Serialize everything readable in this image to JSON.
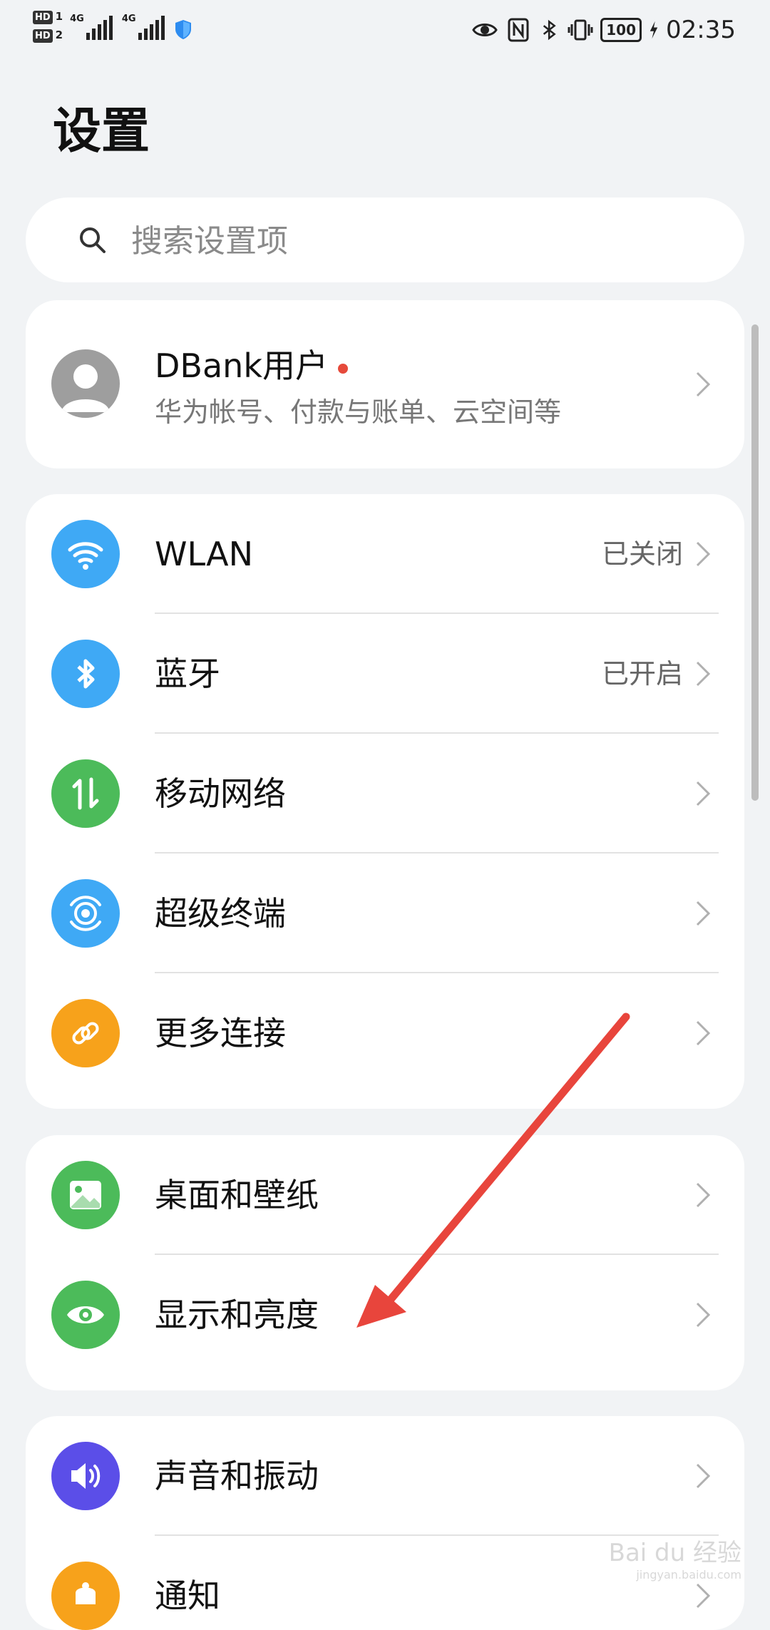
{
  "status_bar": {
    "sim1_label": "HD",
    "sim1_num": "1",
    "sim2_label": "HD",
    "sim2_num": "2",
    "network1": "4G",
    "network2": "4G",
    "battery": "100",
    "time": "02:35"
  },
  "page": {
    "title": "设置"
  },
  "search": {
    "placeholder": "搜索设置项"
  },
  "account": {
    "name": "DBank用户",
    "subtitle": "华为帐号、付款与账单、云空间等"
  },
  "connectivity": [
    {
      "label": "WLAN",
      "value": "已关闭",
      "icon": "wifi-icon",
      "color": "#3fa9f5"
    },
    {
      "label": "蓝牙",
      "value": "已开启",
      "icon": "bluetooth-icon",
      "color": "#3fa9f5"
    },
    {
      "label": "移动网络",
      "value": "",
      "icon": "mobile-data-icon",
      "color": "#4cbb5a"
    },
    {
      "label": "超级终端",
      "value": "",
      "icon": "super-device-icon",
      "color": "#3fa9f5"
    },
    {
      "label": "更多连接",
      "value": "",
      "icon": "link-icon",
      "color": "#f7a21b"
    }
  ],
  "display": [
    {
      "label": "桌面和壁纸",
      "icon": "wallpaper-icon",
      "color": "#4cbb5a"
    },
    {
      "label": "显示和亮度",
      "icon": "eye-icon",
      "color": "#4cbb5a"
    }
  ],
  "sound": [
    {
      "label": "声音和振动",
      "icon": "speaker-icon",
      "color": "#5b4ee8"
    },
    {
      "label": "通知",
      "icon": "bell-icon",
      "color": "#f7a21b"
    }
  ],
  "watermark": {
    "text": "Bai du 经验",
    "sub": "jingyan.baidu.com"
  }
}
